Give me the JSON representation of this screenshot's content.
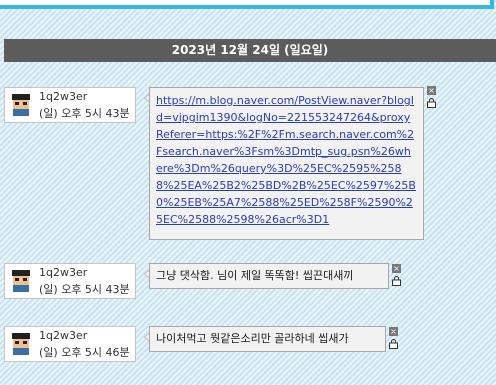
{
  "date_header": "2023년 12월 24일 (일요일)",
  "messages": [
    {
      "sender": "1q2w3er",
      "time": "(일) 오후 5시 43분",
      "text": "https://m.blog.naver.com/PostView.naver?blogId=vipgim1390&logNo=221553247264&proxyReferer=https:%2F%2Fm.search.naver.com%2Fsearch.naver%3Fsm%3Dmtp_sug.psn%26where%3Dm%26query%3D%25EC%2595%2588%25EA%25B2%25BD%2B%25EC%2597%25B0%25EB%25A7%2588%25ED%258F%2590%25EC%2588%2598%26acr%3D1"
    },
    {
      "sender": "1q2w3er",
      "time": "(일) 오후 5시 43분",
      "text": "그냥 댓삭함. 님이 제일 똑똑함! 씹끈대새끼"
    },
    {
      "sender": "1q2w3er",
      "time": "(일) 오후 5시 46분",
      "text": "나이처먹고 뭣같은소리만 골라하네 씹새가"
    }
  ],
  "icons": {
    "close": "×",
    "avatar": "pixel-avatar-icon",
    "lock": "lock-icon"
  }
}
